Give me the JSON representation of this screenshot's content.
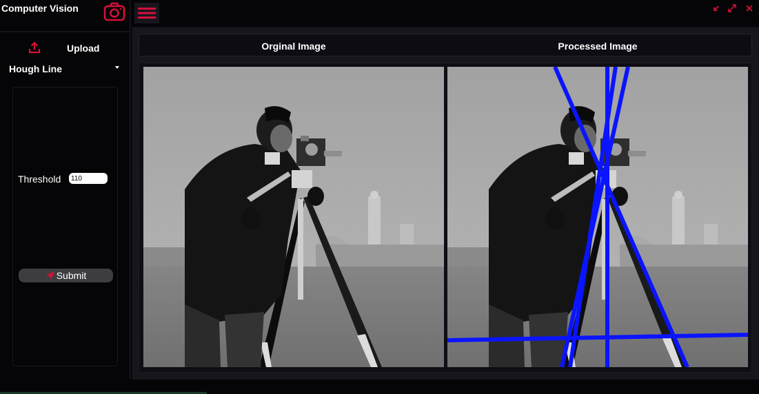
{
  "app": {
    "title": "Computer Vision"
  },
  "sidebar": {
    "upload_label": "Upload",
    "operation": "Hough Line",
    "threshold_label": "Threshold",
    "threshold_value": "110",
    "submit_label": "Submit"
  },
  "main": {
    "original_title": "Orginal Image",
    "processed_title": "Processed Image"
  },
  "colors": {
    "accent": "#d6103a",
    "line_overlay": "#0a14ff"
  },
  "icons": [
    "camera-icon",
    "hamburger-menu-icon",
    "minimize-icon",
    "maximize-icon",
    "close-icon",
    "upload-icon",
    "dropdown-caret-icon",
    "send-icon"
  ]
}
